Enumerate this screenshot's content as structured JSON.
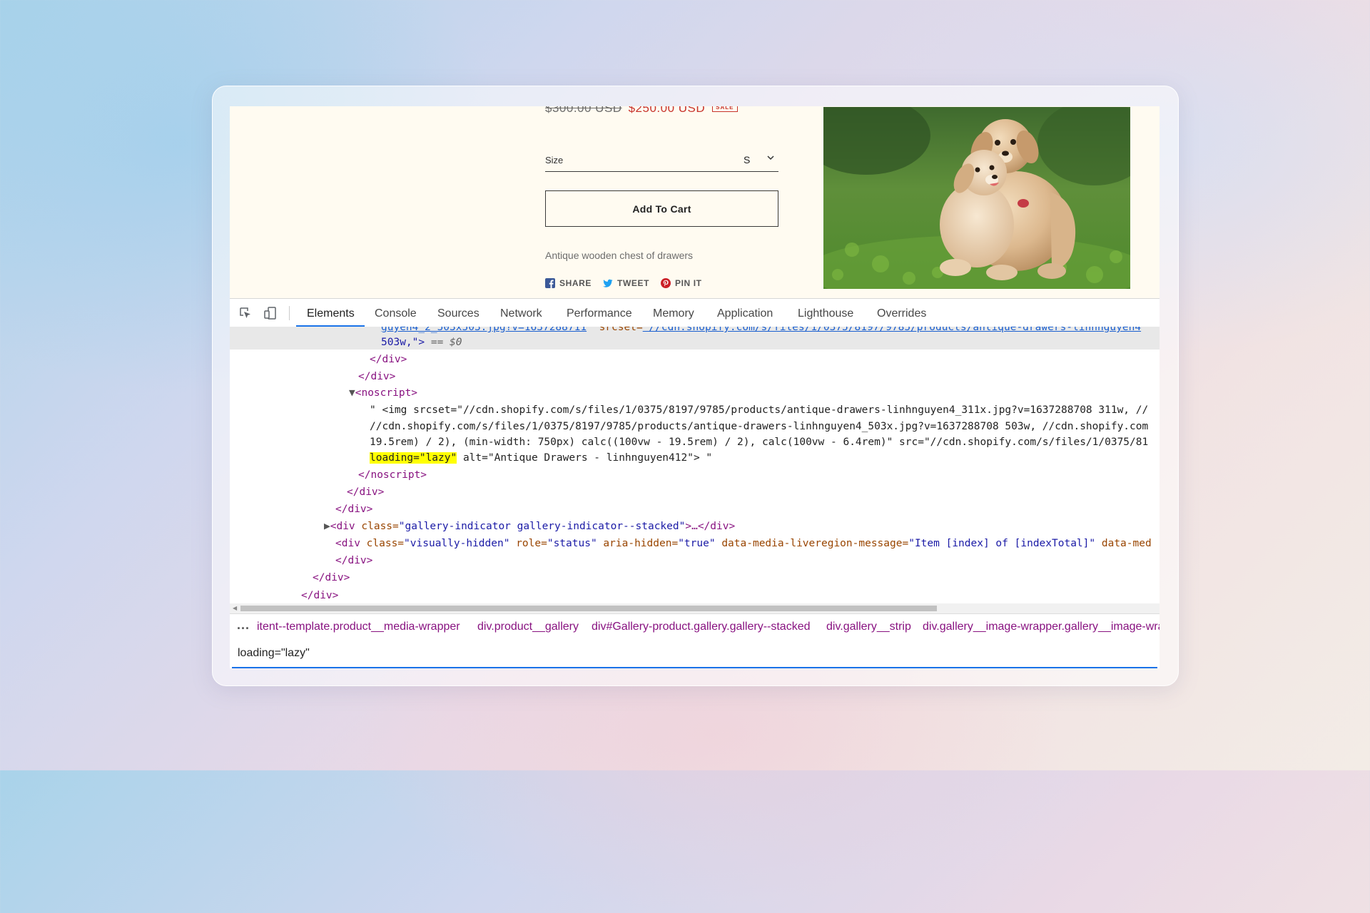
{
  "store": {
    "price_old": "$300.00 USD",
    "price_new": "$250.00 USD",
    "sale_badge": "SALE",
    "size_label": "Size",
    "size_value": "S",
    "add_to_cart": "Add To Cart",
    "description": "Antique wooden chest of drawers",
    "share": "SHARE",
    "tweet": "TWEET",
    "pin": "PIN IT"
  },
  "devtools": {
    "tabs": [
      "Elements",
      "Console",
      "Sources",
      "Network",
      "Performance",
      "Memory",
      "Application",
      "Lighthouse",
      "Overrides"
    ],
    "active_tab": "Elements",
    "code": {
      "l0_pre": "guyen4_2_503x503.jpg?v=1637288711",
      "l0_attr": "srcset=",
      "l0_link": "\"//cdn.shopify.com/s/files/1/0375/8197/9785/products/antique-drawers-linhnguyen4",
      "l1_text": "503w,\">",
      "l1_eq": " == $0",
      "l2": "</div>",
      "l3": "</div>",
      "l4": "<noscript>",
      "l5": "\" <img srcset=\"//cdn.shopify.com/s/files/1/0375/8197/9785/products/antique-drawers-linhnguyen4_311x.jpg?v=1637288708 311w, //",
      "l6": "//cdn.shopify.com/s/files/1/0375/8197/9785/products/antique-drawers-linhnguyen4_503x.jpg?v=1637288708 503w, //cdn.shopify.com",
      "l7": "19.5rem) / 2), (min-width: 750px) calc((100vw - 19.5rem) / 2), calc(100vw - 6.4rem)\" src=\"//cdn.shopify.com/s/files/1/0375/81",
      "l8_hl": "loading=\"lazy\"",
      "l8_rest": " alt=\"Antique Drawers - linhnguyen412\"> \"",
      "l9": "</noscript>",
      "l10": "</div>",
      "l11": "</div>",
      "l12_tag": "<div",
      "l12_attr": "class=",
      "l12_val": "\"gallery-indicator gallery-indicator--stacked\"",
      "l12_end": ">…</div>",
      "l13_tag": "<div",
      "l13_a1": "class=",
      "l13_v1": "\"visually-hidden\"",
      "l13_a2": "role=",
      "l13_v2": "\"status\"",
      "l13_a3": "aria-hidden=",
      "l13_v3": "\"true\"",
      "l13_a4": "data-media-liveregion-message=",
      "l13_v4": "\"Item [index] of [indexTotal]\"",
      "l13_a5": "data-med",
      "l14": "</div>",
      "l15": "</div>",
      "l16": "</div>"
    },
    "breadcrumbs": [
      "...",
      "itent--template.product__media-wrapper",
      "div.product__gallery",
      "div#Gallery-product.gallery.gallery--stacked",
      "div.gallery__strip",
      "div.gallery__image-wrapper.gallery__image-wra"
    ],
    "search_value": "loading=\"lazy\""
  },
  "colors": {
    "accent": "#1a73e8",
    "sale_red": "#c8342c",
    "tag": "#881280",
    "attr": "#994500",
    "value": "#1a1aa6",
    "highlight": "#ffff00"
  }
}
